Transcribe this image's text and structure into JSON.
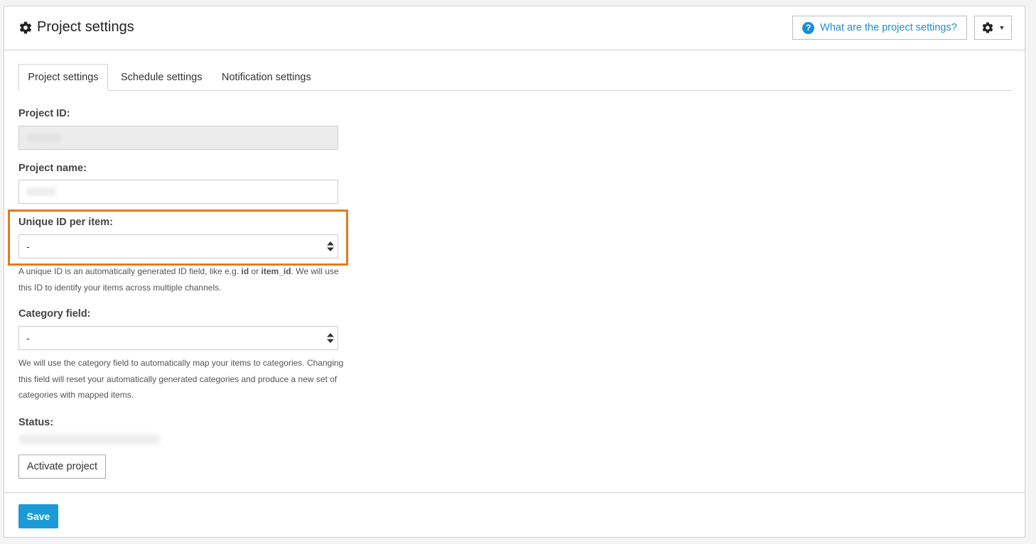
{
  "header": {
    "title": "Project settings",
    "help_label": "What are the project settings?",
    "help_icon": "question-circle-icon",
    "menu_icon": "gear-icon"
  },
  "tabs": [
    {
      "label": "Project settings",
      "active": true
    },
    {
      "label": "Schedule settings",
      "active": false
    },
    {
      "label": "Notification settings",
      "active": false
    }
  ],
  "form": {
    "project_id_label": "Project ID:",
    "project_name_label": "Project name:",
    "unique_id_label": "Unique ID per item:",
    "unique_id_value": "-",
    "unique_id_help_1": "A unique ID is an automatically generated ID field, like e.g. ",
    "unique_id_help_id": "id",
    "unique_id_help_or": " or ",
    "unique_id_help_item_id": "item_id",
    "unique_id_help_2": ". We will use this ID to identify your items across multiple channels.",
    "category_label": "Category field:",
    "category_value": "-",
    "category_help": "We will use the category field to automatically map your items to categories. Changing this field will reset your automatically generated categories and produce a new set of categories with mapped items.",
    "status_label": "Status:",
    "activate_label": "Activate project"
  },
  "footer": {
    "save_label": "Save"
  },
  "colors": {
    "accent": "#1a9ad6",
    "link": "#1a8fd0",
    "highlight": "#e07b1e"
  }
}
